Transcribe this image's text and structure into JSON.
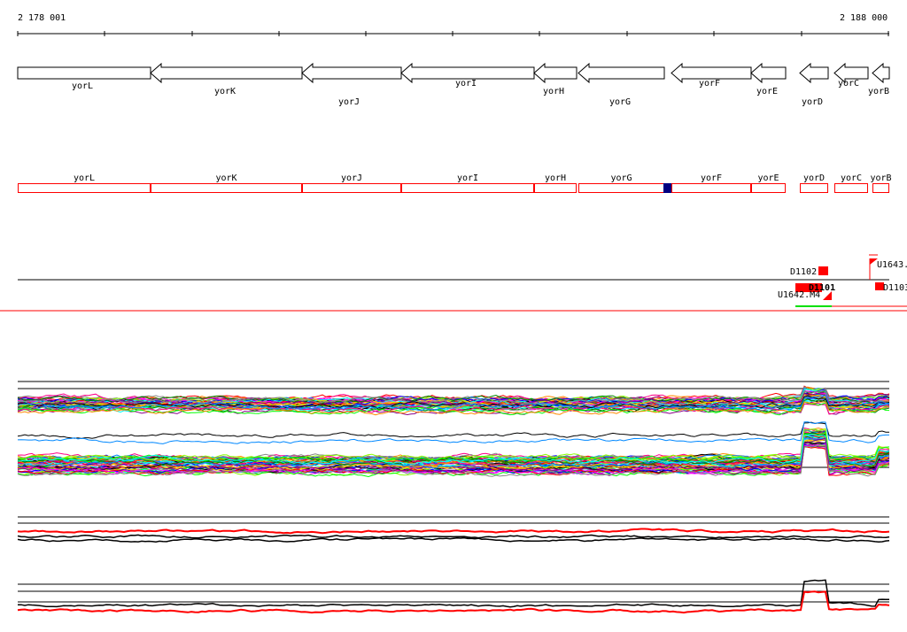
{
  "ruler": {
    "start_label": "2 178 001",
    "end_label": "2 188 000"
  },
  "genes": [
    "yorL",
    "yorK",
    "yorJ",
    "yorI",
    "yorH",
    "yorG",
    "yorF",
    "yorE",
    "yorD",
    "yorC",
    "yorB"
  ],
  "features": {
    "d1102": "D1102",
    "d1101": "D1101",
    "d1103": "D1103",
    "u1643": "U1643.",
    "u1642": "U1642.M4"
  },
  "colors": {
    "red": "#ff0000",
    "blue": "#000080",
    "green": "#00e000"
  }
}
